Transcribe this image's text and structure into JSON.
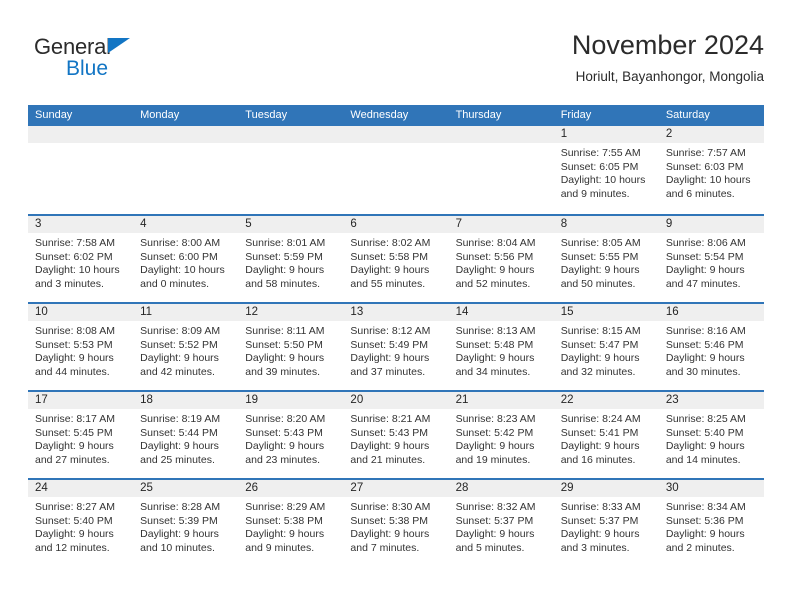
{
  "brand": {
    "word1": "General",
    "word2": "Blue",
    "triangle_color": "#1275c4"
  },
  "header": {
    "title": "November 2024",
    "subtitle": "Horiult, Bayanhongor, Mongolia"
  },
  "theme": {
    "header_blue": "#3075b8",
    "daynum_gray": "#efefef",
    "text": "#262626"
  },
  "calendar": {
    "weekday_headers": [
      "Sunday",
      "Monday",
      "Tuesday",
      "Wednesday",
      "Thursday",
      "Friday",
      "Saturday"
    ],
    "weeks": [
      [
        {
          "day": "",
          "lines": []
        },
        {
          "day": "",
          "lines": []
        },
        {
          "day": "",
          "lines": []
        },
        {
          "day": "",
          "lines": []
        },
        {
          "day": "",
          "lines": []
        },
        {
          "day": "1",
          "lines": [
            "Sunrise: 7:55 AM",
            "Sunset: 6:05 PM",
            "Daylight: 10 hours",
            "and 9 minutes."
          ]
        },
        {
          "day": "2",
          "lines": [
            "Sunrise: 7:57 AM",
            "Sunset: 6:03 PM",
            "Daylight: 10 hours",
            "and 6 minutes."
          ]
        }
      ],
      [
        {
          "day": "3",
          "lines": [
            "Sunrise: 7:58 AM",
            "Sunset: 6:02 PM",
            "Daylight: 10 hours",
            "and 3 minutes."
          ]
        },
        {
          "day": "4",
          "lines": [
            "Sunrise: 8:00 AM",
            "Sunset: 6:00 PM",
            "Daylight: 10 hours",
            "and 0 minutes."
          ]
        },
        {
          "day": "5",
          "lines": [
            "Sunrise: 8:01 AM",
            "Sunset: 5:59 PM",
            "Daylight: 9 hours",
            "and 58 minutes."
          ]
        },
        {
          "day": "6",
          "lines": [
            "Sunrise: 8:02 AM",
            "Sunset: 5:58 PM",
            "Daylight: 9 hours",
            "and 55 minutes."
          ]
        },
        {
          "day": "7",
          "lines": [
            "Sunrise: 8:04 AM",
            "Sunset: 5:56 PM",
            "Daylight: 9 hours",
            "and 52 minutes."
          ]
        },
        {
          "day": "8",
          "lines": [
            "Sunrise: 8:05 AM",
            "Sunset: 5:55 PM",
            "Daylight: 9 hours",
            "and 50 minutes."
          ]
        },
        {
          "day": "9",
          "lines": [
            "Sunrise: 8:06 AM",
            "Sunset: 5:54 PM",
            "Daylight: 9 hours",
            "and 47 minutes."
          ]
        }
      ],
      [
        {
          "day": "10",
          "lines": [
            "Sunrise: 8:08 AM",
            "Sunset: 5:53 PM",
            "Daylight: 9 hours",
            "and 44 minutes."
          ]
        },
        {
          "day": "11",
          "lines": [
            "Sunrise: 8:09 AM",
            "Sunset: 5:52 PM",
            "Daylight: 9 hours",
            "and 42 minutes."
          ]
        },
        {
          "day": "12",
          "lines": [
            "Sunrise: 8:11 AM",
            "Sunset: 5:50 PM",
            "Daylight: 9 hours",
            "and 39 minutes."
          ]
        },
        {
          "day": "13",
          "lines": [
            "Sunrise: 8:12 AM",
            "Sunset: 5:49 PM",
            "Daylight: 9 hours",
            "and 37 minutes."
          ]
        },
        {
          "day": "14",
          "lines": [
            "Sunrise: 8:13 AM",
            "Sunset: 5:48 PM",
            "Daylight: 9 hours",
            "and 34 minutes."
          ]
        },
        {
          "day": "15",
          "lines": [
            "Sunrise: 8:15 AM",
            "Sunset: 5:47 PM",
            "Daylight: 9 hours",
            "and 32 minutes."
          ]
        },
        {
          "day": "16",
          "lines": [
            "Sunrise: 8:16 AM",
            "Sunset: 5:46 PM",
            "Daylight: 9 hours",
            "and 30 minutes."
          ]
        }
      ],
      [
        {
          "day": "17",
          "lines": [
            "Sunrise: 8:17 AM",
            "Sunset: 5:45 PM",
            "Daylight: 9 hours",
            "and 27 minutes."
          ]
        },
        {
          "day": "18",
          "lines": [
            "Sunrise: 8:19 AM",
            "Sunset: 5:44 PM",
            "Daylight: 9 hours",
            "and 25 minutes."
          ]
        },
        {
          "day": "19",
          "lines": [
            "Sunrise: 8:20 AM",
            "Sunset: 5:43 PM",
            "Daylight: 9 hours",
            "and 23 minutes."
          ]
        },
        {
          "day": "20",
          "lines": [
            "Sunrise: 8:21 AM",
            "Sunset: 5:43 PM",
            "Daylight: 9 hours",
            "and 21 minutes."
          ]
        },
        {
          "day": "21",
          "lines": [
            "Sunrise: 8:23 AM",
            "Sunset: 5:42 PM",
            "Daylight: 9 hours",
            "and 19 minutes."
          ]
        },
        {
          "day": "22",
          "lines": [
            "Sunrise: 8:24 AM",
            "Sunset: 5:41 PM",
            "Daylight: 9 hours",
            "and 16 minutes."
          ]
        },
        {
          "day": "23",
          "lines": [
            "Sunrise: 8:25 AM",
            "Sunset: 5:40 PM",
            "Daylight: 9 hours",
            "and 14 minutes."
          ]
        }
      ],
      [
        {
          "day": "24",
          "lines": [
            "Sunrise: 8:27 AM",
            "Sunset: 5:40 PM",
            "Daylight: 9 hours",
            "and 12 minutes."
          ]
        },
        {
          "day": "25",
          "lines": [
            "Sunrise: 8:28 AM",
            "Sunset: 5:39 PM",
            "Daylight: 9 hours",
            "and 10 minutes."
          ]
        },
        {
          "day": "26",
          "lines": [
            "Sunrise: 8:29 AM",
            "Sunset: 5:38 PM",
            "Daylight: 9 hours",
            "and 9 minutes."
          ]
        },
        {
          "day": "27",
          "lines": [
            "Sunrise: 8:30 AM",
            "Sunset: 5:38 PM",
            "Daylight: 9 hours",
            "and 7 minutes."
          ]
        },
        {
          "day": "28",
          "lines": [
            "Sunrise: 8:32 AM",
            "Sunset: 5:37 PM",
            "Daylight: 9 hours",
            "and 5 minutes."
          ]
        },
        {
          "day": "29",
          "lines": [
            "Sunrise: 8:33 AM",
            "Sunset: 5:37 PM",
            "Daylight: 9 hours",
            "and 3 minutes."
          ]
        },
        {
          "day": "30",
          "lines": [
            "Sunrise: 8:34 AM",
            "Sunset: 5:36 PM",
            "Daylight: 9 hours",
            "and 2 minutes."
          ]
        }
      ]
    ]
  }
}
